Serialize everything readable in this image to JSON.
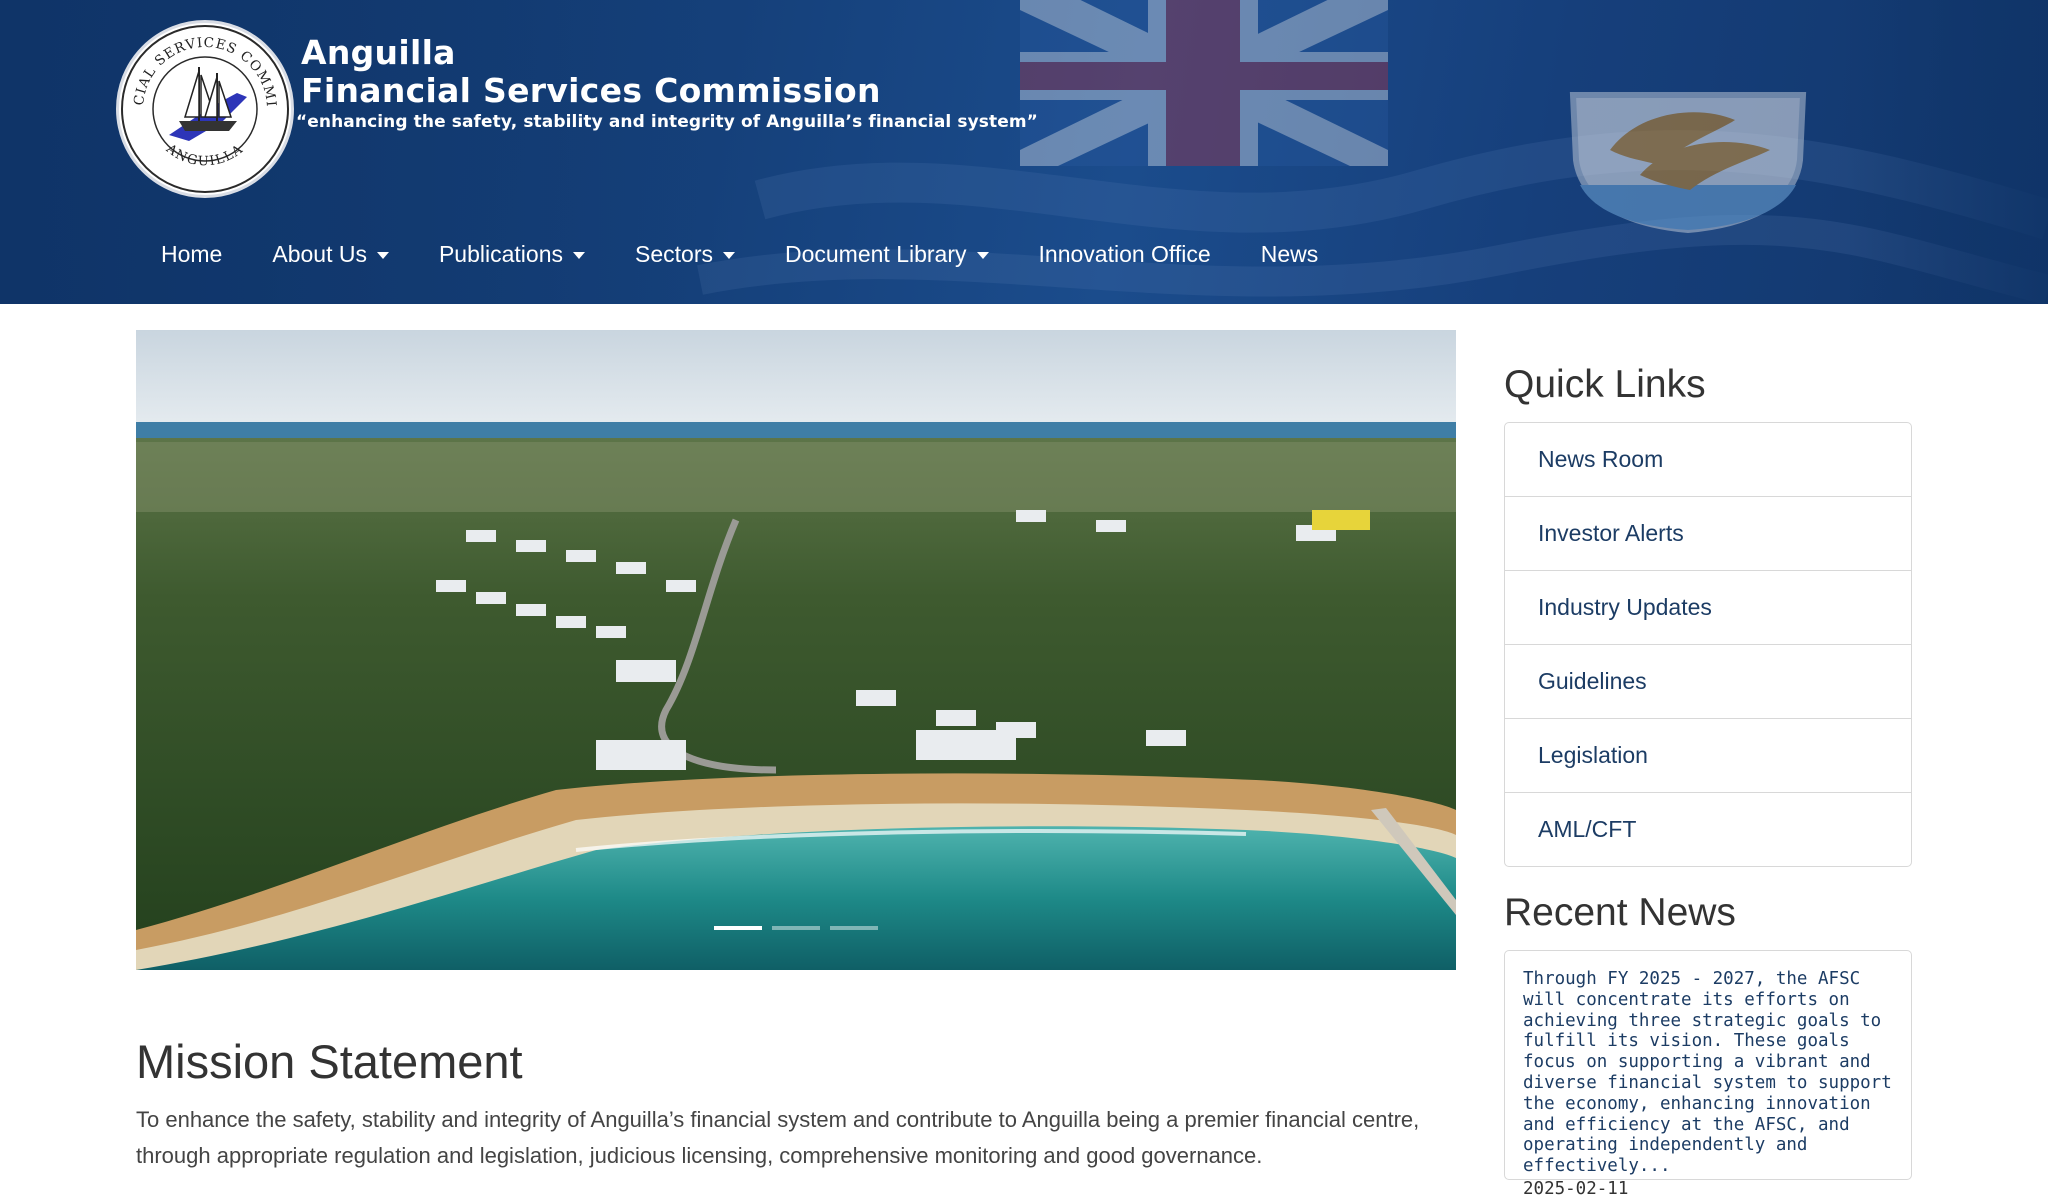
{
  "header": {
    "title_line1": "Anguilla",
    "title_line2": "Financial Services Commission",
    "tagline": "“enhancing the safety, stability and integrity of Anguilla’s financial system”",
    "seal_text_top": "FINANCIAL SERVICES COMMISSION",
    "seal_text_bottom": "ANGUILLA"
  },
  "nav": {
    "items": [
      {
        "label": "Home",
        "dropdown": false
      },
      {
        "label": "About Us",
        "dropdown": true
      },
      {
        "label": "Publications",
        "dropdown": true
      },
      {
        "label": "Sectors",
        "dropdown": true
      },
      {
        "label": "Document Library",
        "dropdown": true
      },
      {
        "label": "Innovation Office",
        "dropdown": false
      },
      {
        "label": "News",
        "dropdown": false
      }
    ]
  },
  "carousel": {
    "slide_count": 3,
    "active_index": 0
  },
  "mission": {
    "title": "Mission Statement",
    "text": "To enhance the safety, stability and integrity of Anguilla’s financial system and contribute to Anguilla being a premier financial centre, through appropriate regulation and legislation, judicious licensing, comprehensive monitoring and good governance."
  },
  "quick_links": {
    "heading": "Quick Links",
    "items": [
      "News Room",
      "Investor Alerts",
      "Industry Updates",
      "Guidelines",
      "Legislation",
      "AML/CFT"
    ]
  },
  "recent_news": {
    "heading": "Recent News",
    "items": [
      {
        "text": "Through FY 2025 - 2027, the AFSC will concentrate its efforts on achieving three strategic goals to fulfill its vision. These goals focus on supporting a vibrant and diverse financial system to support the economy, enhancing innovation and efficiency at the AFSC, and operating independently and effectively...",
        "date": "2025-02-11"
      }
    ]
  },
  "colors": {
    "header_blue": "#15407a",
    "link_navy": "#1c3c64",
    "heading_gray": "#333333"
  }
}
